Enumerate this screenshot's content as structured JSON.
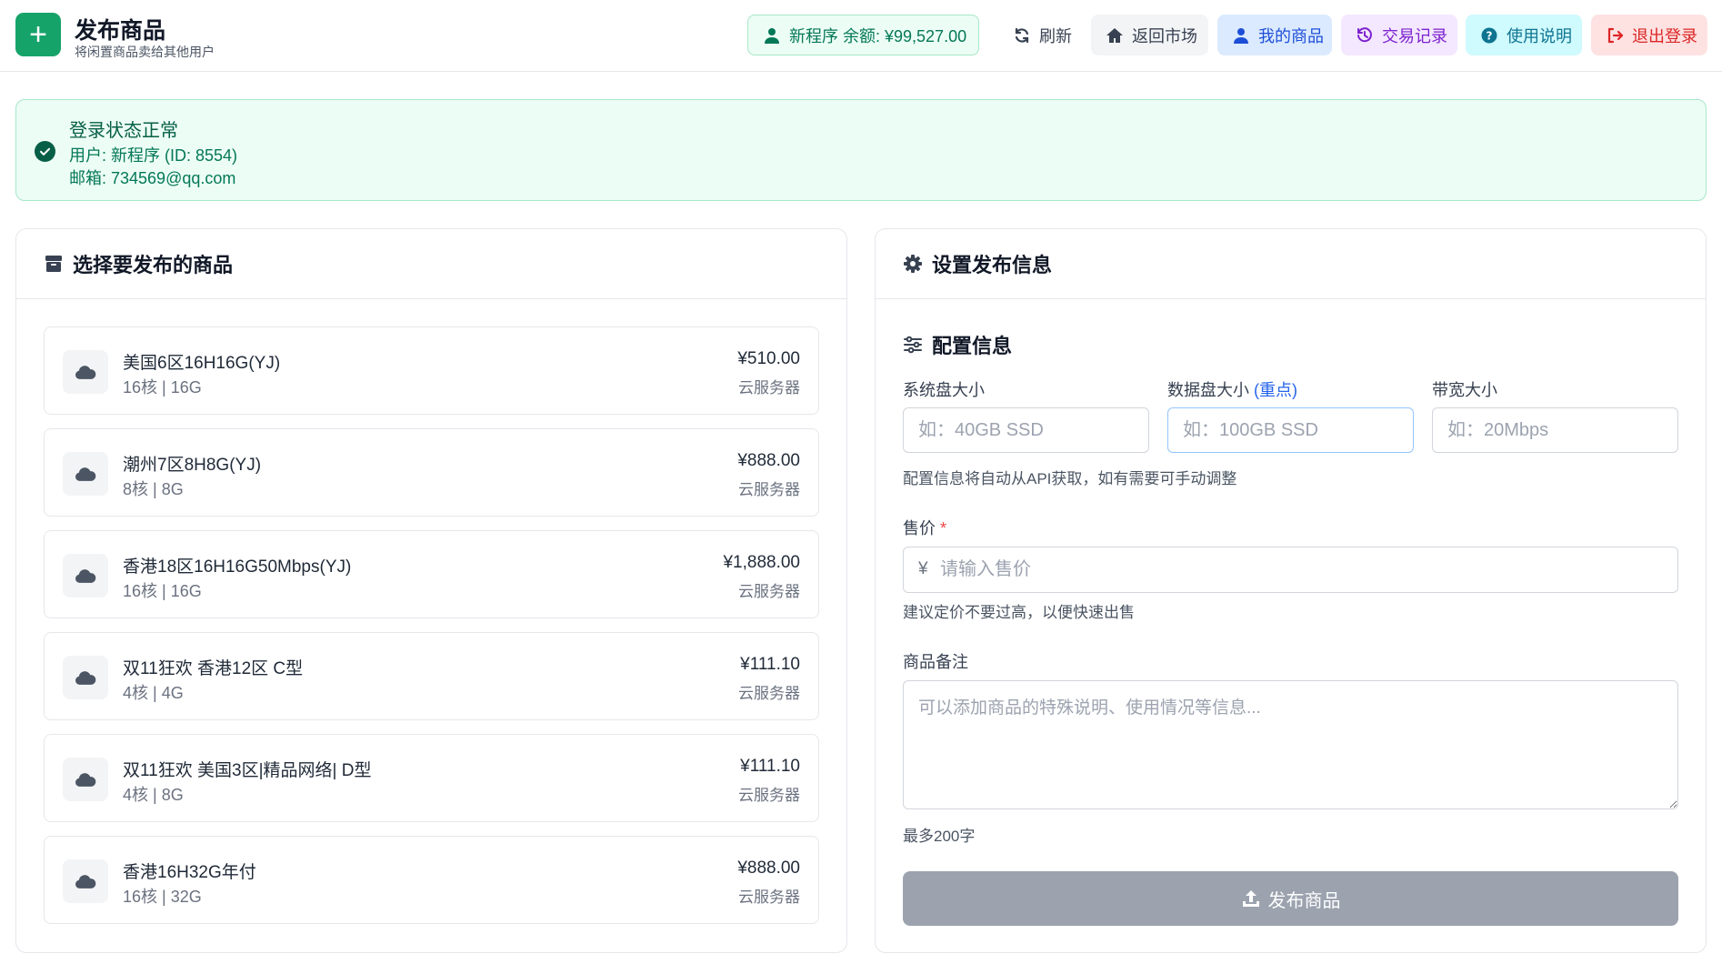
{
  "header": {
    "logo_glyph": "+",
    "title": "发布商品",
    "subtitle": "将闲置商品卖给其他用户",
    "user_badge": "新程序  余额: ¥99,527.00",
    "refresh_label": "刷新",
    "market_label": "返回市场",
    "my_items_label": "我的商品",
    "trades_label": "交易记录",
    "help_label": "使用说明",
    "logout_label": "退出登录"
  },
  "alert": {
    "title": "登录状态正常",
    "user_line": "用户: 新程序 (ID: 8554)",
    "email_line": "邮箱: 734569@qq.com"
  },
  "left_panel": {
    "title": "选择要发布的商品",
    "products": [
      {
        "name": "美国6区16H16G(YJ)",
        "spec": "16核 | 16G",
        "price": "¥510.00",
        "type": "云服务器"
      },
      {
        "name": "潮州7区8H8G(YJ)",
        "spec": "8核 | 8G",
        "price": "¥888.00",
        "type": "云服务器"
      },
      {
        "name": "香港18区16H16G50Mbps(YJ)",
        "spec": "16核 | 16G",
        "price": "¥1,888.00",
        "type": "云服务器"
      },
      {
        "name": "双11狂欢 香港12区 C型",
        "spec": "4核 | 4G",
        "price": "¥111.10",
        "type": "云服务器"
      },
      {
        "name": "双11狂欢 美国3区|精品网络| D型",
        "spec": "4核 | 8G",
        "price": "¥111.10",
        "type": "云服务器"
      },
      {
        "name": "香港16H32G年付",
        "spec": "16核 | 32G",
        "price": "¥888.00",
        "type": "云服务器"
      }
    ]
  },
  "right_panel": {
    "title": "设置发布信息",
    "config_title": "配置信息",
    "system_disk_label": "系统盘大小",
    "system_disk_placeholder": "如：40GB SSD",
    "data_disk_label": "数据盘大小",
    "data_disk_highlight": "(重点)",
    "data_disk_placeholder": "如：100GB SSD",
    "bandwidth_label": "带宽大小",
    "bandwidth_placeholder": "如：20Mbps",
    "config_hint": "配置信息将自动从API获取，如有需要可手动调整",
    "price_label": "售价",
    "required_mark": "*",
    "currency_symbol": "¥",
    "price_placeholder": "请输入售价",
    "price_hint": "建议定价不要过高，以便快速出售",
    "remarks_label": "商品备注",
    "remarks_placeholder": "可以添加商品的特殊说明、使用情况等信息...",
    "remarks_hint": "最多200字",
    "submit_label": "发布商品"
  },
  "colors": {
    "brand_green": "#16a36a",
    "success_bg": "#ecfdf5",
    "submit_disabled": "#9ca3af",
    "link_blue": "#2563eb"
  }
}
